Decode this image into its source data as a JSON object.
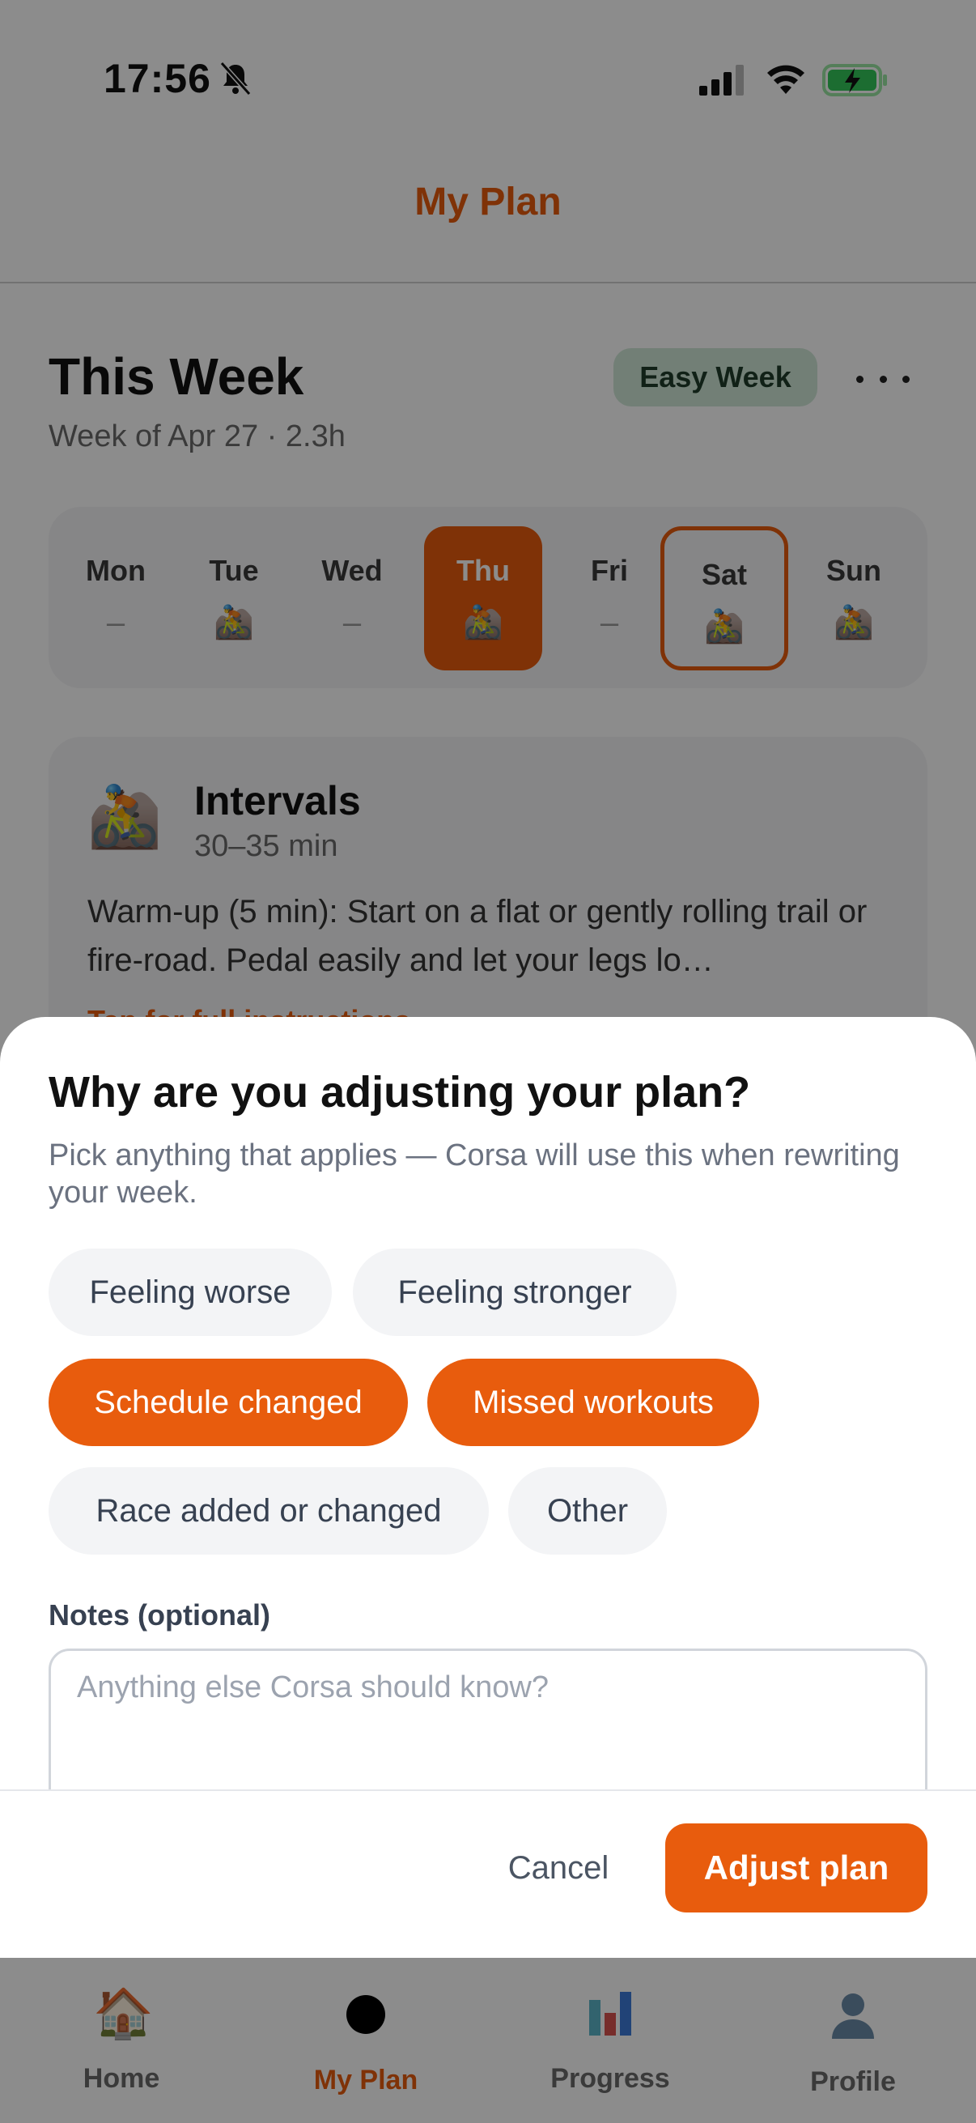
{
  "status_bar": {
    "time": "17:56"
  },
  "nav": {
    "title": "My Plan"
  },
  "week": {
    "title": "This Week",
    "subtitle": "Week of Apr 27 · 2.3h",
    "badge": "Easy Week",
    "days": [
      {
        "label": "Mon",
        "value": "–"
      },
      {
        "label": "Tue",
        "value": "🚵"
      },
      {
        "label": "Wed",
        "value": "–"
      },
      {
        "label": "Thu",
        "value": "🚵"
      },
      {
        "label": "Fri",
        "value": "–"
      },
      {
        "label": "Sat",
        "value": "🚵"
      },
      {
        "label": "Sun",
        "value": "🚵"
      }
    ]
  },
  "workout": {
    "icon": "🚵",
    "name": "Intervals",
    "duration": "30–35 min",
    "description": "Warm-up (5 min): Start on a flat or gently rolling trail or fire-road. Pedal easily and let your legs lo…",
    "link": "Tap for full instructions ›"
  },
  "sheet": {
    "title": "Why are you adjusting your plan?",
    "subtitle": "Pick anything that applies — Corsa will use this when rewriting your week.",
    "chips": [
      {
        "label": "Feeling worse",
        "selected": false
      },
      {
        "label": "Feeling stronger",
        "selected": false
      },
      {
        "label": "Schedule changed",
        "selected": true
      },
      {
        "label": "Missed workouts",
        "selected": true
      },
      {
        "label": "Race added or changed",
        "selected": false
      },
      {
        "label": "Other",
        "selected": false
      }
    ],
    "notes_label": "Notes (optional)",
    "notes_placeholder": "Anything else Corsa should know?",
    "notes_value": "",
    "cancel_label": "Cancel",
    "submit_label": "Adjust plan"
  },
  "tabbar": {
    "items": [
      {
        "label": "Home",
        "icon": "🏠"
      },
      {
        "label": "My Plan",
        "icon": ""
      },
      {
        "label": "Progress",
        "icon": ""
      },
      {
        "label": "Profile",
        "icon": ""
      }
    ],
    "active": "My Plan"
  },
  "colors": {
    "accent": "#e85c0d",
    "badge_bg": "#cfe8d8",
    "chip_bg": "#f3f4f6"
  }
}
